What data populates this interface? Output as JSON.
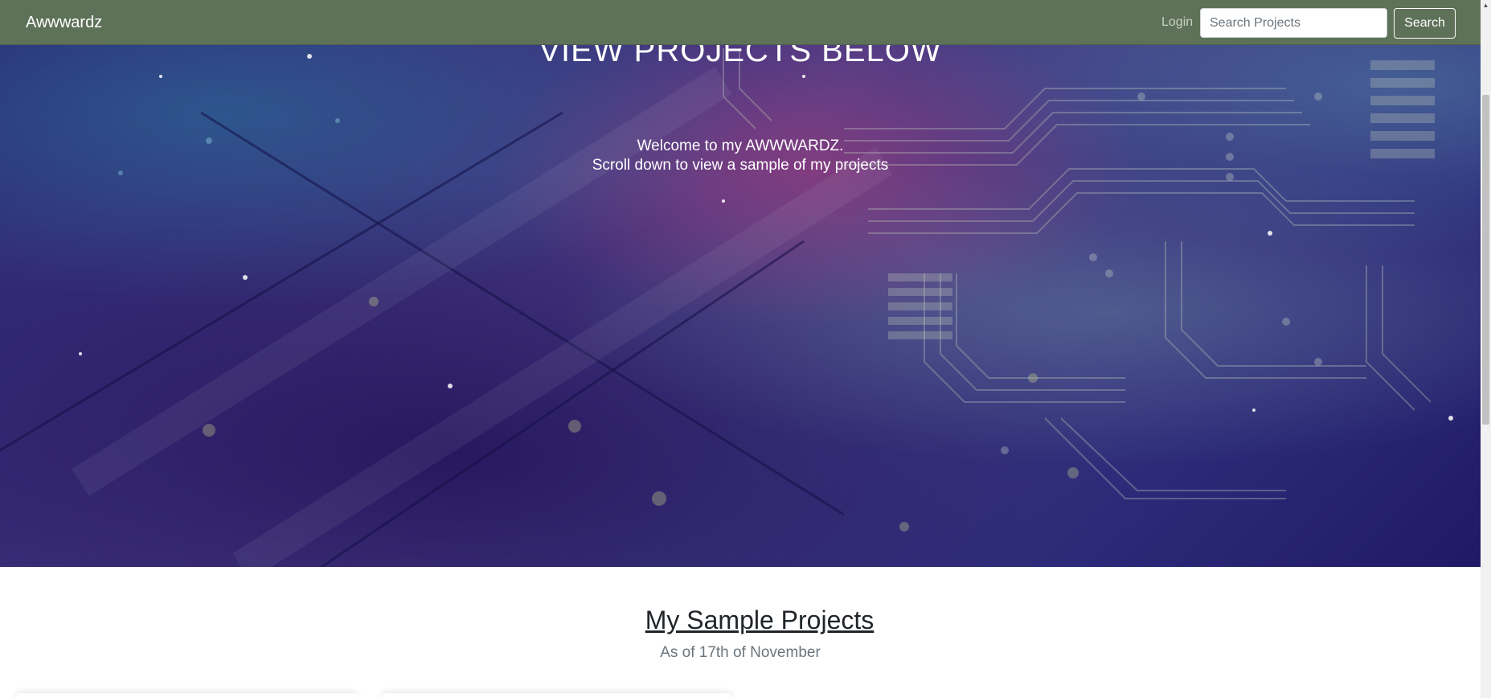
{
  "navbar": {
    "brand": "Awwwardz",
    "login_label": "Login",
    "search_placeholder": "Search Projects",
    "search_value": "",
    "search_button_label": "Search",
    "bg_color": "#5e7259"
  },
  "hero": {
    "title": "VIEW PROJECTS BELOW",
    "line1": "Welcome to my AWWWARDZ.",
    "line2": "Scroll down to view a sample of my projects"
  },
  "projects_section": {
    "title": "My Sample Projects",
    "subtitle": "As of 17th of November"
  },
  "scrollbar": {
    "up_arrow_icon": "triangle-up"
  }
}
